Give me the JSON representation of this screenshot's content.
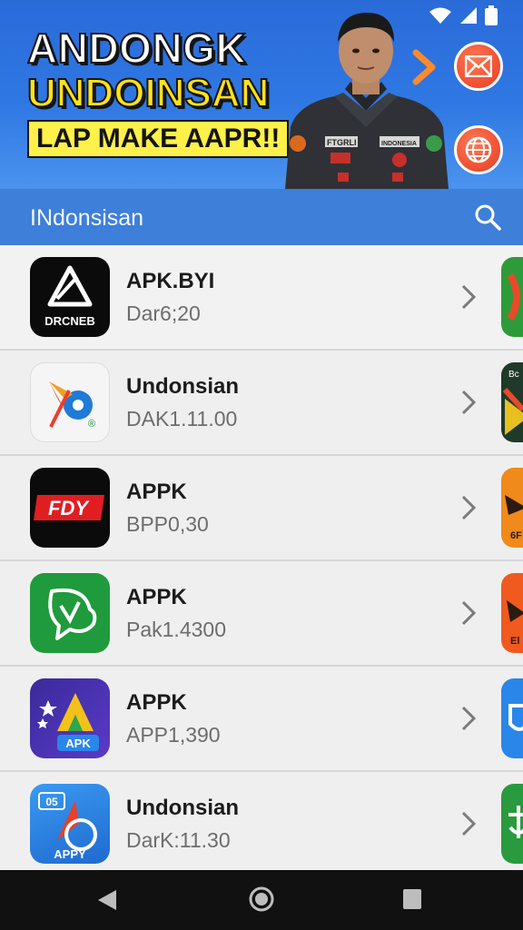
{
  "banner": {
    "line1": "ANDONGK",
    "line2": "UNDOINSAN",
    "line3": "LAP MAKE AAPR!!",
    "uniform_badge_left": "FTGRLI",
    "uniform_badge_right": "INDONESIA",
    "icons": [
      "wifi-icon",
      "signal-icon",
      "battery-icon",
      "chevron-right-icon",
      "mail-icon",
      "globe-icon"
    ]
  },
  "appbar": {
    "title": "INdonsisan",
    "search_icon": "search-icon"
  },
  "apps": [
    {
      "name": "APK.BYI",
      "sub": "Dar6;20",
      "icon_text": "DRCNEB",
      "peek_color": "#2e9b3a"
    },
    {
      "name": "Undonsian",
      "sub": "DAK1.11.00",
      "icon_text": "®",
      "peek_color": "#1f3a2a"
    },
    {
      "name": "APPK",
      "sub": "BPP0,30",
      "icon_text": "FDY",
      "peek_color": "#f08a1a"
    },
    {
      "name": "APPK",
      "sub": "Pak1.4300",
      "icon_text": "",
      "peek_color": "#f05a1e"
    },
    {
      "name": "APPK",
      "sub": "APP1,390",
      "icon_text": "APK",
      "peek_color": "#2a86e8"
    },
    {
      "name": "Undonsian",
      "sub": "DarK:11.30",
      "icon_text": "APPY",
      "icon_badge": "05",
      "peek_color": "#2a9a3e"
    }
  ],
  "peeks": {
    "row2": "Bc",
    "row3": "6F",
    "row4": "El"
  },
  "navbar": {
    "back": "back-icon",
    "home": "home-icon",
    "recents": "recents-icon"
  },
  "colors": {
    "banner_blue": "#2f78e3",
    "appbar_blue": "#3d7fd9",
    "accent_yellow": "#ffe11c",
    "accent_red": "#e53a20"
  }
}
